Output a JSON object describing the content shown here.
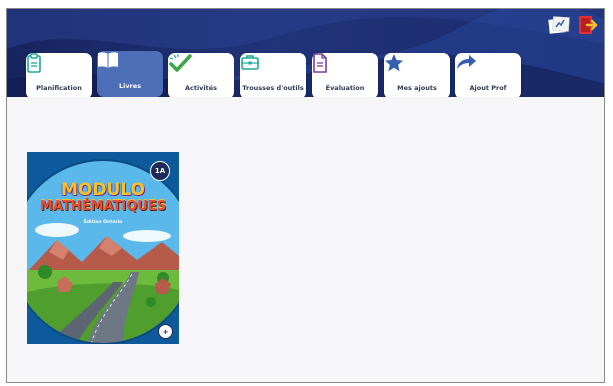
{
  "tabs": [
    {
      "label": "Planification",
      "icon": "clipboard-icon"
    },
    {
      "label": "Livres",
      "icon": "book-icon"
    },
    {
      "label": "Activités",
      "icon": "checkmark-icon"
    },
    {
      "label": "Trousses d'outils",
      "icon": "toolkit-icon"
    },
    {
      "label": "Évaluation",
      "icon": "document-icon"
    },
    {
      "label": "Mes ajouts",
      "icon": "star-icon"
    },
    {
      "label": "Ajout Prof",
      "icon": "share-arrow-icon"
    }
  ],
  "active_tab": "Livres",
  "colors": {
    "header_bg": "#1a2a6b",
    "active_tab": "#4c6fb7",
    "icon_teal": "#1fa89a",
    "icon_purple": "#7a3fa0",
    "icon_blue": "#3560b0",
    "check_green": "#3aa845"
  },
  "book": {
    "title_line1": "MODULO",
    "title_line2": "MATHÉMATIQUES",
    "edition": "Édition Ontario",
    "badge": "1A",
    "zoom_symbol": "+"
  }
}
